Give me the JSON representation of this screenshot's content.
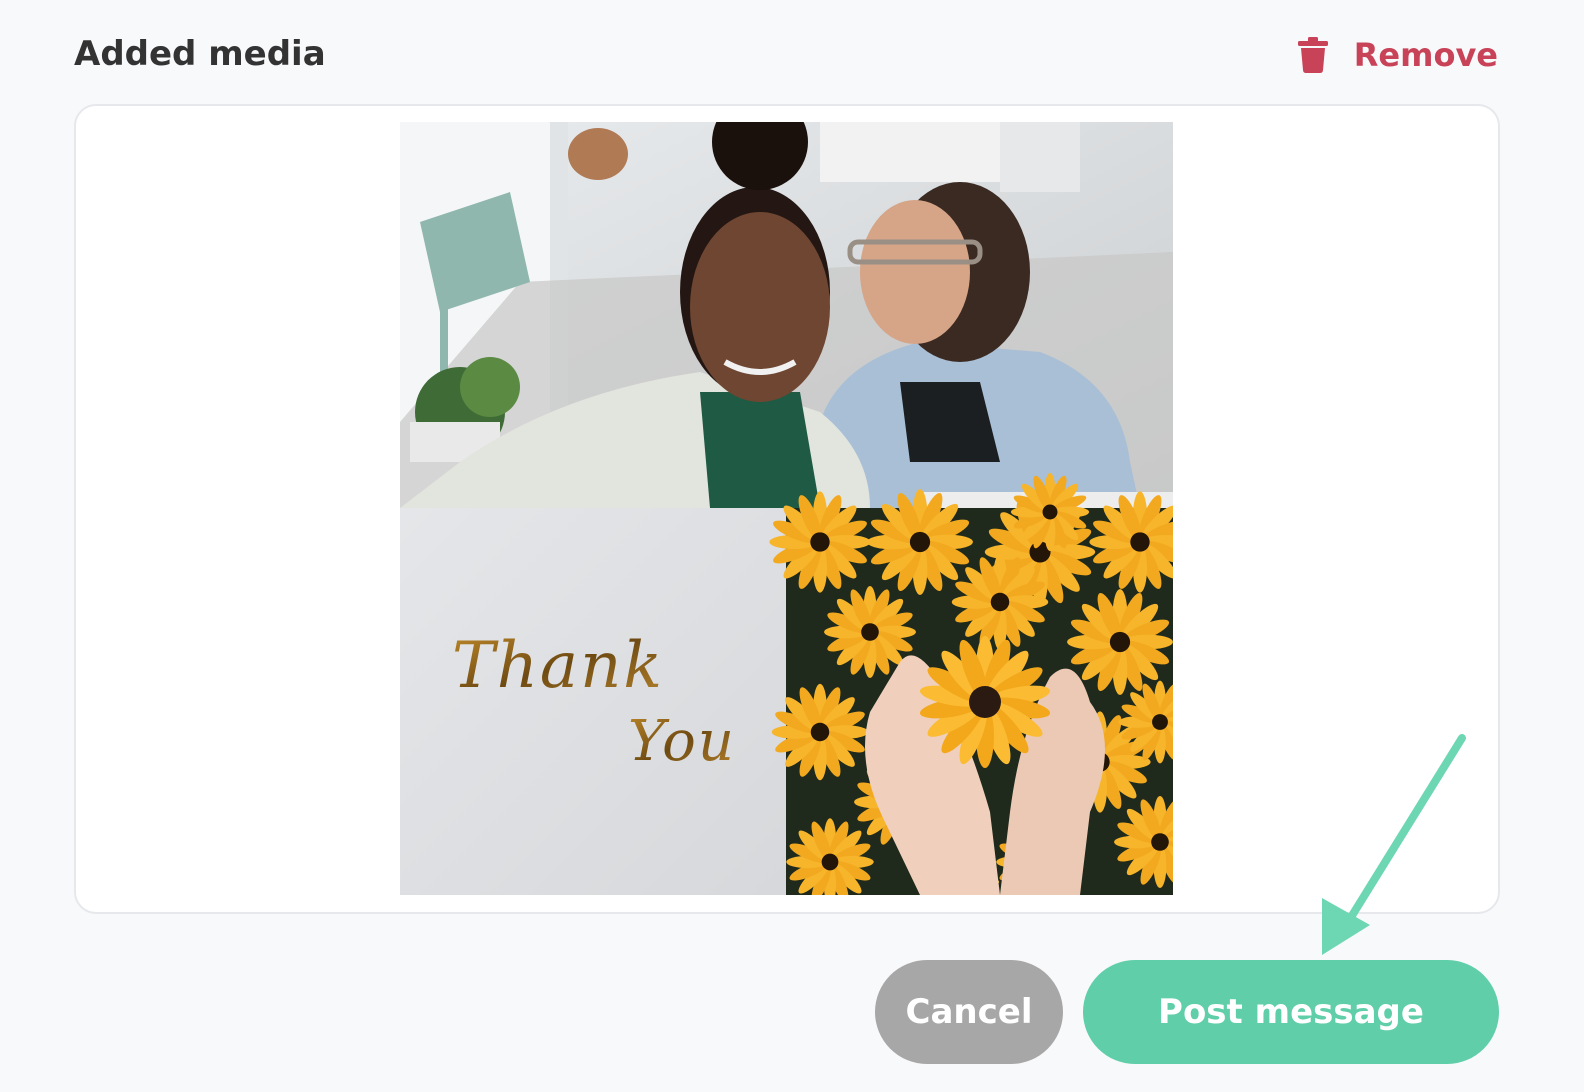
{
  "header": {
    "title": "Added media",
    "remove_label": "Remove"
  },
  "media": {
    "card_text_line1": "Thank",
    "card_text_line2": "You"
  },
  "actions": {
    "cancel_label": "Cancel",
    "post_label": "Post message"
  },
  "colors": {
    "accent": "#5fcea9",
    "danger": "#c94358",
    "cancel": "#a7a7a7",
    "annotation_arrow": "#6dd6b2"
  },
  "icons": {
    "remove": "trash-icon",
    "annotation": "arrow-annotation"
  }
}
